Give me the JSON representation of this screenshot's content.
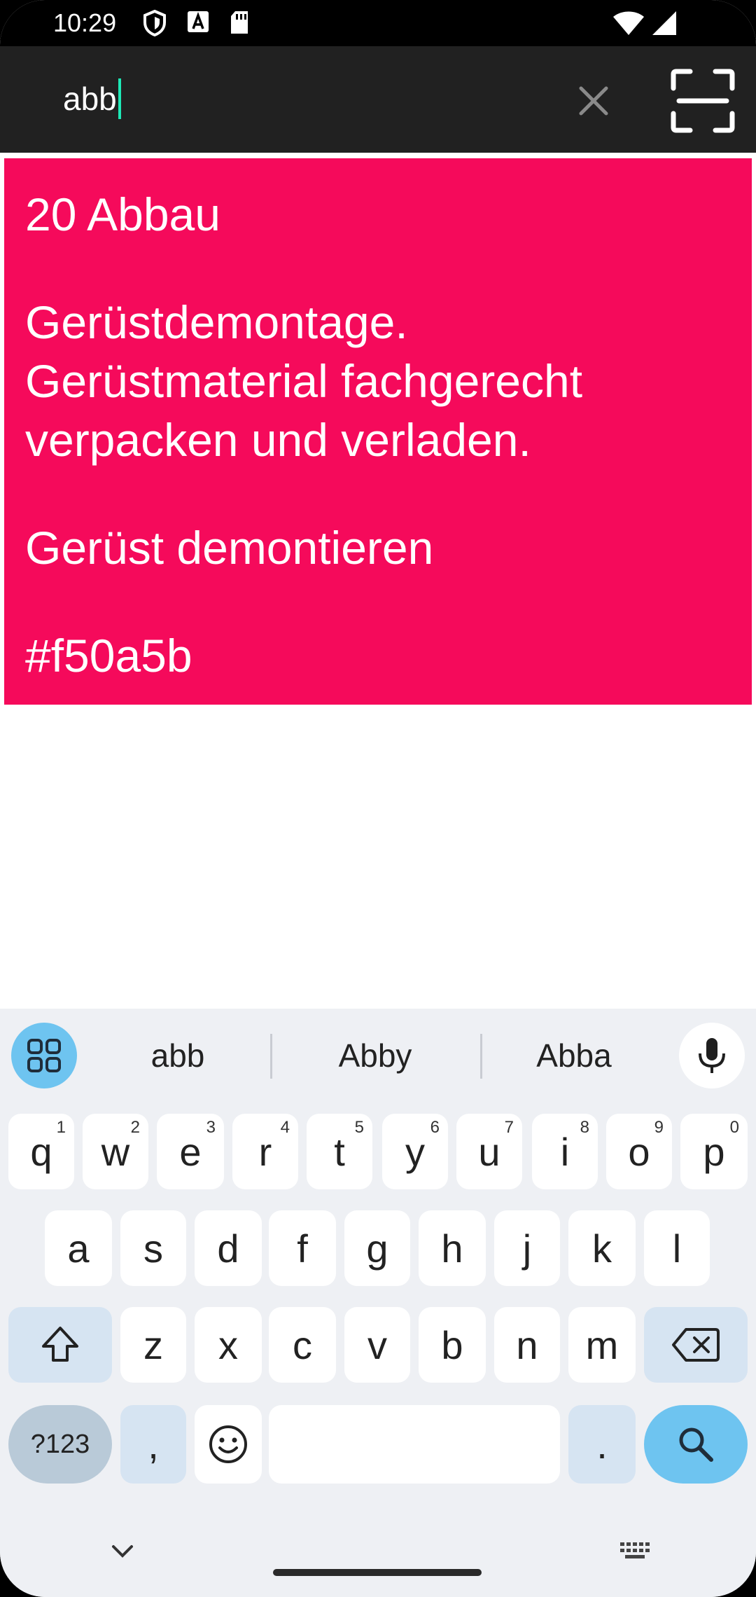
{
  "status_bar": {
    "time": "10:29"
  },
  "search": {
    "query": "abb"
  },
  "result_card": {
    "color": "#f50a5b",
    "title": "20 Abbau",
    "description_lines": [
      "Gerüstdemontage.",
      "Gerüstmaterial fachgerecht",
      "verpacken und verladen."
    ],
    "subtitle": "Gerüst demontieren",
    "color_code": "#f50a5b"
  },
  "keyboard": {
    "suggestions": [
      "abb",
      "Abby",
      "Abba"
    ],
    "row1": [
      {
        "key": "q",
        "hint": "1"
      },
      {
        "key": "w",
        "hint": "2"
      },
      {
        "key": "e",
        "hint": "3"
      },
      {
        "key": "r",
        "hint": "4"
      },
      {
        "key": "t",
        "hint": "5"
      },
      {
        "key": "y",
        "hint": "6"
      },
      {
        "key": "u",
        "hint": "7"
      },
      {
        "key": "i",
        "hint": "8"
      },
      {
        "key": "o",
        "hint": "9"
      },
      {
        "key": "p",
        "hint": "0"
      }
    ],
    "row2": [
      "a",
      "s",
      "d",
      "f",
      "g",
      "h",
      "j",
      "k",
      "l"
    ],
    "row3": [
      "z",
      "x",
      "c",
      "v",
      "b",
      "n",
      "m"
    ],
    "symbols_label": "?123",
    "comma_label": ",",
    "period_label": "."
  }
}
